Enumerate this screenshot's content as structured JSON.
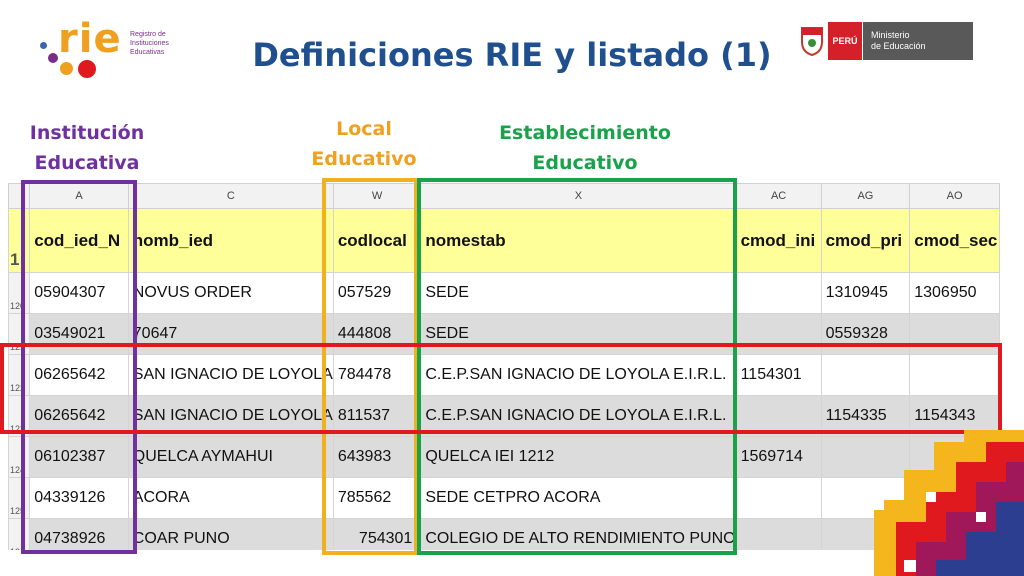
{
  "logo": {
    "word": "rie",
    "subtitle": "Registro de Instituciones Educativas"
  },
  "title": "Definiciones RIE y listado (1)",
  "ministry": {
    "country": "PERÚ",
    "name_line1": "Ministerio",
    "name_line2": "de Educación"
  },
  "labels": {
    "institucion_line1": "Institución",
    "institucion_line2": "Educativa",
    "local_line1": "Local",
    "local_line2": "Educativo",
    "establecimiento_line1": "Establecimiento",
    "establecimiento_line2": "Educativo"
  },
  "colors": {
    "purple": "#7030a0",
    "orange": "#f0b020",
    "green": "#1aa24a",
    "red": "#e0191f",
    "title": "#1f4f8f"
  },
  "sheet": {
    "col_letters": [
      "A",
      "C",
      "W",
      "X",
      "AC",
      "AG",
      "AO"
    ],
    "header_row_num": "1",
    "headers": [
      "cod_ied_N",
      "nomb_ied",
      "codlocal",
      "nomestab",
      "cmod_ini",
      "cmod_pri",
      "cmod_sec"
    ],
    "rows": [
      {
        "num": "120",
        "cells": [
          "05904307",
          "NOVUS ORDER",
          "057529",
          "SEDE",
          "",
          "1310945",
          "1306950"
        ]
      },
      {
        "num": "121",
        "cells": [
          "03549021",
          "70647",
          "444808",
          "SEDE",
          "",
          "0559328",
          ""
        ]
      },
      {
        "num": "122",
        "cells": [
          "06265642",
          "SAN IGNACIO DE LOYOLA",
          "784478",
          "C.E.P.SAN IGNACIO DE LOYOLA E.I.R.L.",
          "1154301",
          "",
          ""
        ]
      },
      {
        "num": "123",
        "cells": [
          "06265642",
          "SAN IGNACIO DE LOYOLA",
          "811537",
          "C.E.P.SAN IGNACIO DE LOYOLA E.I.R.L.",
          "",
          "1154335",
          "1154343"
        ]
      },
      {
        "num": "124",
        "cells": [
          "06102387",
          "QUELCA AYMAHUI",
          "643983",
          "QUELCA IEI 1212",
          "1569714",
          "",
          ""
        ]
      },
      {
        "num": "125",
        "cells": [
          "04339126",
          "ACORA",
          "785562",
          "SEDE CETPRO ACORA",
          "",
          "",
          ""
        ]
      },
      {
        "num": "126",
        "cells": [
          "04738926",
          "COAR PUNO",
          "754301",
          "COLEGIO DE ALTO RENDIMIENTO PUNO",
          "",
          "",
          ""
        ]
      }
    ]
  }
}
